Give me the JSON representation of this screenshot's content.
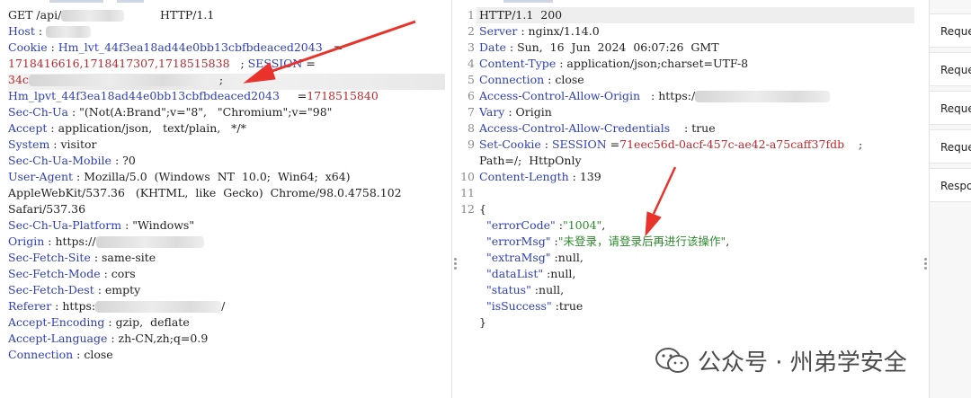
{
  "request": {
    "lines": [
      {
        "parts": [
          {
            "t": "GET /api/",
            "c": "v"
          },
          {
            "blur": 70
          },
          {
            "t": "          HTTP/1.1",
            "c": "v"
          }
        ]
      },
      {
        "parts": [
          {
            "t": "Host",
            "c": "k"
          },
          {
            "t": " : ",
            "c": "v"
          },
          {
            "blur": 50
          }
        ]
      },
      {
        "parts": [
          {
            "t": "Cookie",
            "c": "k"
          },
          {
            "t": " : ",
            "c": "v"
          },
          {
            "t": "Hm_lvt_44f3ea18ad44e0bb13cbfbdeaced2043",
            "c": "k"
          },
          {
            "t": "   =",
            "c": "v"
          }
        ]
      },
      {
        "parts": [
          {
            "t": "1718416616,1718417307,1718515838",
            "c": "red"
          },
          {
            "t": "   ; ",
            "c": "v"
          },
          {
            "t": "SESSION",
            "c": "k"
          },
          {
            "t": " =",
            "c": "v"
          }
        ]
      },
      {
        "parts": [
          {
            "t": "34c",
            "c": "red"
          },
          {
            "blur": 200
          },
          {
            "t": "   ;",
            "c": "v"
          }
        ]
      },
      {
        "parts": [
          {
            "t": "Hm_lpvt_44f3ea18ad44e0bb13cbfbdeaced2043",
            "c": "k"
          },
          {
            "t": "     =",
            "c": "v"
          },
          {
            "t": "1718515840",
            "c": "red"
          }
        ]
      },
      {
        "parts": [
          {
            "t": "Sec-Ch-Ua",
            "c": "k"
          },
          {
            "t": " : \"(Not(A:Brand\";v=\"8\",   \"Chromium\";v=\"98\"",
            "c": "v"
          }
        ]
      },
      {
        "parts": [
          {
            "t": "Accept",
            "c": "k"
          },
          {
            "t": " : application/json,   text/plain,   */*",
            "c": "v"
          }
        ]
      },
      {
        "parts": [
          {
            "t": "System",
            "c": "k"
          },
          {
            "t": " : visitor",
            "c": "v"
          }
        ]
      },
      {
        "parts": [
          {
            "t": "Sec-Ch-Ua-Mobile",
            "c": "k"
          },
          {
            "t": " : ?0",
            "c": "v"
          }
        ]
      },
      {
        "parts": [
          {
            "t": "User-Agent",
            "c": "k"
          },
          {
            "t": " : Mozilla/5.0  (Windows  NT  10.0;  Win64;  x64)",
            "c": "v"
          }
        ]
      },
      {
        "parts": [
          {
            "t": "AppleWebKit/537.36   (KHTML,  like  Gecko)  Chrome/98.0.4758.102",
            "c": "v"
          }
        ]
      },
      {
        "parts": [
          {
            "t": "Safari/537.36",
            "c": "v"
          }
        ]
      },
      {
        "parts": [
          {
            "t": "Sec-Ch-Ua-Platform",
            "c": "k"
          },
          {
            "t": " : \"Windows\"",
            "c": "v"
          }
        ]
      },
      {
        "parts": [
          {
            "t": "Origin",
            "c": "k"
          },
          {
            "t": " : https://",
            "c": "v"
          },
          {
            "blur": 120
          }
        ]
      },
      {
        "parts": [
          {
            "t": "Sec-Fetch-Site",
            "c": "k"
          },
          {
            "t": " : same-site",
            "c": "v"
          }
        ]
      },
      {
        "parts": [
          {
            "t": "Sec-Fetch-Mode",
            "c": "k"
          },
          {
            "t": " : cors",
            "c": "v"
          }
        ]
      },
      {
        "parts": [
          {
            "t": "Sec-Fetch-Dest",
            "c": "k"
          },
          {
            "t": " : empty",
            "c": "v"
          }
        ]
      },
      {
        "parts": [
          {
            "t": "Referer",
            "c": "k"
          },
          {
            "t": " : https:",
            "c": "v"
          },
          {
            "blur": 140
          },
          {
            "t": "/",
            "c": "v"
          }
        ]
      },
      {
        "parts": [
          {
            "t": "Accept-Encoding",
            "c": "k"
          },
          {
            "t": " : gzip,  deflate",
            "c": "v"
          }
        ]
      },
      {
        "parts": [
          {
            "t": "Accept-Language",
            "c": "k"
          },
          {
            "t": " : zh-CN,zh;q=0.9",
            "c": "v"
          }
        ]
      },
      {
        "parts": [
          {
            "t": "Connection",
            "c": "k"
          },
          {
            "t": " : close",
            "c": "v"
          }
        ]
      }
    ]
  },
  "response": {
    "lines": [
      {
        "n": "1",
        "parts": [
          {
            "t": "HTTP/1.1  200",
            "c": "v"
          }
        ]
      },
      {
        "n": "2",
        "parts": [
          {
            "t": "Server",
            "c": "k"
          },
          {
            "t": " : nginx/1.14.0",
            "c": "v"
          }
        ]
      },
      {
        "n": "3",
        "parts": [
          {
            "t": "Date",
            "c": "k"
          },
          {
            "t": " : Sun,  16  Jun  2024  06:07:26  GMT",
            "c": "v"
          }
        ]
      },
      {
        "n": "4",
        "parts": [
          {
            "t": "Content-Type",
            "c": "k"
          },
          {
            "t": " : application/json;charset=UTF-8",
            "c": "v"
          }
        ]
      },
      {
        "n": "5",
        "parts": [
          {
            "t": "Connection",
            "c": "k"
          },
          {
            "t": " : close",
            "c": "v"
          }
        ]
      },
      {
        "n": "6",
        "parts": [
          {
            "t": "Access-Control-Allow-Origin",
            "c": "k"
          },
          {
            "t": "   : https:/",
            "c": "v"
          },
          {
            "blur": 150
          }
        ]
      },
      {
        "n": "7",
        "parts": [
          {
            "t": "Vary",
            "c": "k"
          },
          {
            "t": " : Origin",
            "c": "v"
          }
        ]
      },
      {
        "n": "8",
        "parts": [
          {
            "t": "Access-Control-Allow-Credentials",
            "c": "k"
          },
          {
            "t": "    : true",
            "c": "v"
          }
        ]
      },
      {
        "n": "9",
        "parts": [
          {
            "t": "Set-Cookie",
            "c": "k"
          },
          {
            "t": " : ",
            "c": "v"
          },
          {
            "t": "SESSION",
            "c": "k"
          },
          {
            "t": " =",
            "c": "v"
          },
          {
            "t": "71eec56d-0acf-457c-ae42-a75caff37fdb",
            "c": "red"
          },
          {
            "t": "    ;",
            "c": "v"
          }
        ]
      },
      {
        "n": "",
        "parts": [
          {
            "t": "Path=/;  HttpOnly",
            "c": "v"
          }
        ]
      },
      {
        "n": "10",
        "parts": [
          {
            "t": "Content-Length",
            "c": "k"
          },
          {
            "t": " : 139",
            "c": "v"
          }
        ]
      },
      {
        "n": "11",
        "parts": []
      },
      {
        "n": "12",
        "parts": [
          {
            "t": "{",
            "c": "v"
          }
        ]
      },
      {
        "n": "",
        "parts": [
          {
            "t": "  \"errorCode\"",
            "c": "k"
          },
          {
            "t": " :",
            "c": "v"
          },
          {
            "t": "\"1004\"",
            "c": "strk"
          },
          {
            "t": ",",
            "c": "v"
          }
        ]
      },
      {
        "n": "",
        "parts": [
          {
            "t": "  \"errorMsg\"",
            "c": "k"
          },
          {
            "t": " :",
            "c": "v"
          },
          {
            "t": "\"未登录，请登录后再进行该操作\"",
            "c": "strk"
          },
          {
            "t": ",",
            "c": "v"
          }
        ]
      },
      {
        "n": "",
        "parts": [
          {
            "t": "  \"extraMsg\"",
            "c": "k"
          },
          {
            "t": " :null,",
            "c": "v"
          }
        ]
      },
      {
        "n": "",
        "parts": [
          {
            "t": "  \"dataList\"",
            "c": "k"
          },
          {
            "t": " :null,",
            "c": "v"
          }
        ]
      },
      {
        "n": "",
        "parts": [
          {
            "t": "  \"status\"",
            "c": "k"
          },
          {
            "t": " :null,",
            "c": "v"
          }
        ]
      },
      {
        "n": "",
        "parts": [
          {
            "t": "  \"isSuccess\"",
            "c": "k"
          },
          {
            "t": " :true",
            "c": "v"
          }
        ]
      },
      {
        "n": "",
        "parts": [
          {
            "t": "}",
            "c": "v"
          }
        ]
      }
    ]
  },
  "sidebar": {
    "items": [
      "Reque",
      "Reque",
      "Reque",
      "Reque",
      "Respo"
    ]
  },
  "watermark": {
    "text": "公众号 · 州弟学安全"
  },
  "colors": {
    "key": "#2e3fb8",
    "cookie_value": "#c0272d",
    "string_value": "#2b8a2b",
    "annotation_arrow": "#e8322b"
  }
}
